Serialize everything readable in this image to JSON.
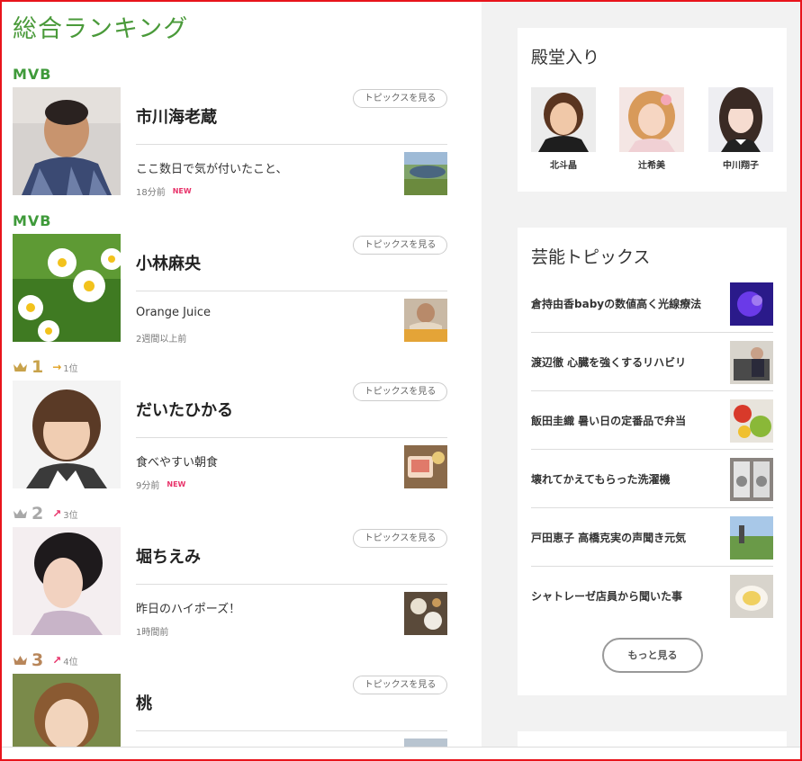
{
  "page": {
    "title": "総合ランキング"
  },
  "ranking": [
    {
      "label_type": "mvb",
      "label": "MVB",
      "name": "市川海老蔵",
      "topics_button": "トピックスを見る",
      "post_title": "ここ数日で気が付いたこと、",
      "post_time": "18分前",
      "is_new": true,
      "new_label": "NEW"
    },
    {
      "label_type": "mvb",
      "label": "MVB",
      "name": "小林麻央",
      "topics_button": "トピックスを見る",
      "post_title": "Orange Juice",
      "post_time": "2週間以上前",
      "is_new": false
    },
    {
      "label_type": "rank",
      "rank": "1",
      "crown_color": "#c8a24a",
      "trend_arrow": "→",
      "trend_color": "#e0a020",
      "trend_text": "1位",
      "name": "だいたひかる",
      "topics_button": "トピックスを見る",
      "post_title": "食べやすい朝食",
      "post_time": "9分前",
      "is_new": true,
      "new_label": "NEW"
    },
    {
      "label_type": "rank",
      "rank": "2",
      "crown_color": "#a8a8a8",
      "trend_arrow": "↗",
      "trend_color": "#e8336a",
      "trend_text": "3位",
      "name": "堀ちえみ",
      "topics_button": "トピックスを見る",
      "post_title": "昨日のハイポーズ！",
      "post_time": "1時間前",
      "is_new": false
    },
    {
      "label_type": "rank",
      "rank": "3",
      "crown_color": "#b8865a",
      "trend_arrow": "↗",
      "trend_color": "#e8336a",
      "trend_text": "4位",
      "name": "桃",
      "topics_button": "トピックスを見る"
    }
  ],
  "hall_of_fame": {
    "title": "殿堂入り",
    "people": [
      {
        "name": "北斗晶"
      },
      {
        "name": "辻希美"
      },
      {
        "name": "中川翔子"
      }
    ]
  },
  "entertainment_topics": {
    "title": "芸能トピックス",
    "items": [
      {
        "text": "倉持由香babyの数値高く光線療法"
      },
      {
        "text": "渡辺徹 心臓を強くするリハビリ"
      },
      {
        "text": "飯田圭織 暑い日の定番品で弁当"
      },
      {
        "text": "壊れてかえてもらった洗濯機"
      },
      {
        "text": "戸田恵子 高橋克実の声聞き元気"
      },
      {
        "text": "シャトレーゼ店員から聞いた事"
      }
    ],
    "more_button": "もっと見る"
  },
  "colors": {
    "accent_green": "#4a9a3a",
    "frame_red": "#e8141c",
    "new_pink": "#e8336a"
  }
}
